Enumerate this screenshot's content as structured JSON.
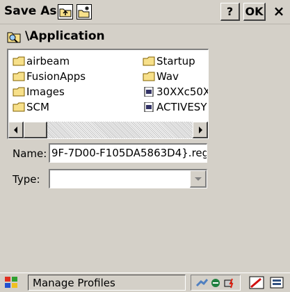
{
  "dialog": {
    "title": "Save As",
    "help_label": "?",
    "ok_label": "OK",
    "close_label": "×"
  },
  "path": "\\Application",
  "files": [
    {
      "name": "airbeam",
      "type": "folder"
    },
    {
      "name": "FusionApps",
      "type": "folder"
    },
    {
      "name": "Images",
      "type": "folder"
    },
    {
      "name": "SCM",
      "type": "folder"
    },
    {
      "name": "Startup",
      "type": "folder"
    },
    {
      "name": "Wav",
      "type": "folder"
    },
    {
      "name": "30XXc50X",
      "type": "file"
    },
    {
      "name": "ACTIVESY",
      "type": "file"
    }
  ],
  "form": {
    "name_label": "Name:",
    "name_value": "9F-7D00-F105DA5863D4}.reg",
    "type_label": "Type:",
    "type_value": ""
  },
  "taskbar": {
    "task_label": "Manage Profiles"
  },
  "colors": {
    "face": "#d4d0c8",
    "folder": "#f7e08a",
    "window": "#ffffff"
  }
}
